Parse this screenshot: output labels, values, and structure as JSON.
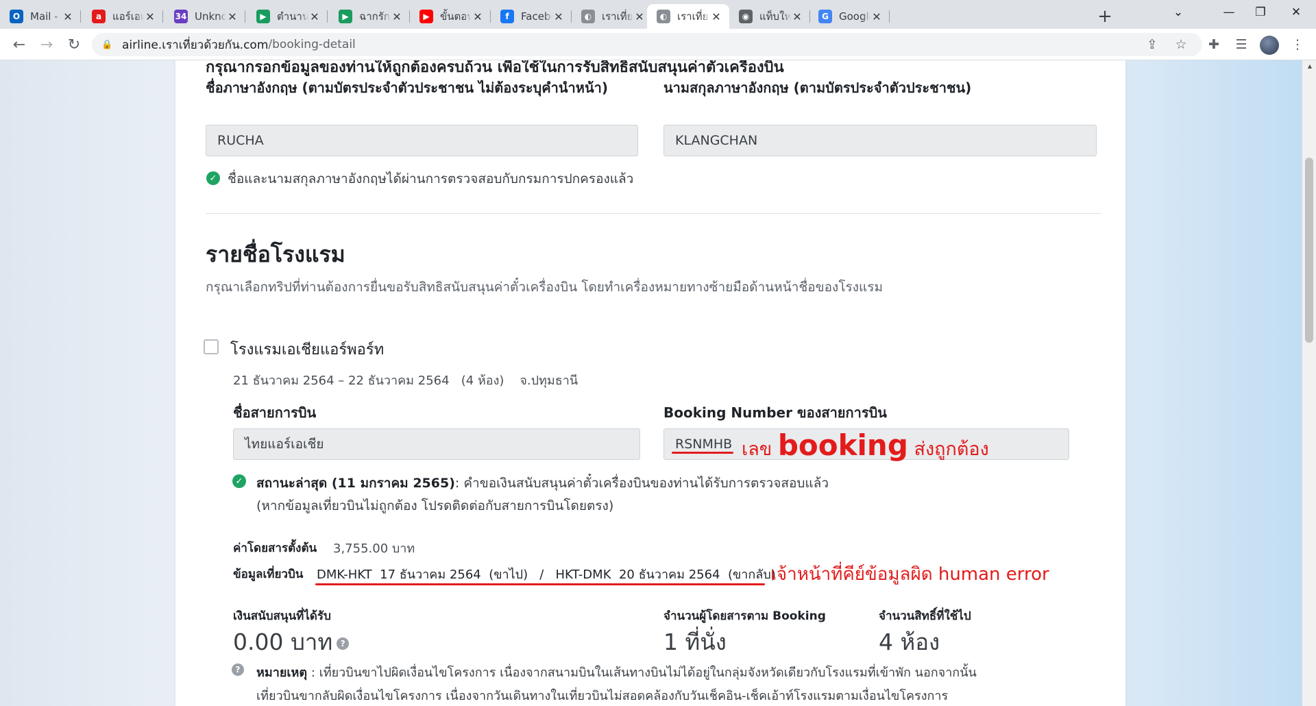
{
  "browser": {
    "tabs": [
      {
        "title": "Mail - หลา",
        "icon": "outlook-icon",
        "color": "#0a64c2",
        "glyph": "O"
      },
      {
        "title": "แอร์เอเชีย |",
        "icon": "airasia-icon",
        "color": "#e31b1b",
        "glyph": "a"
      },
      {
        "title": "Unknown",
        "icon": "channel-34-icon",
        "color": "#6a3dc2",
        "glyph": "34"
      },
      {
        "title": "ตำนานจอมย",
        "icon": "play-icon",
        "color": "#1a9c5f",
        "glyph": "▶"
      },
      {
        "title": "ฉากรักวัยฝั",
        "icon": "play-icon",
        "color": "#1a9c5f",
        "glyph": "▶"
      },
      {
        "title": "ขั้นตอนการ",
        "icon": "youtube-icon",
        "color": "#ff0000",
        "glyph": "▶"
      },
      {
        "title": "Facebook",
        "icon": "facebook-icon",
        "color": "#1877f2",
        "glyph": "f"
      },
      {
        "title": "เราเที่ยวด้วย",
        "icon": "site-icon",
        "color": "#8a8f96",
        "glyph": "◐"
      },
      {
        "title": "เราเที่ยวด้ว",
        "icon": "site-icon",
        "color": "#8a8f96",
        "glyph": "◐"
      },
      {
        "title": "แท็บใหม่",
        "icon": "chrome-icon",
        "color": "#5f6368",
        "glyph": "◉"
      },
      {
        "title": "Google แ",
        "icon": "google-translate-icon",
        "color": "#4285f4",
        "glyph": "G"
      }
    ],
    "url_host": "airline.เราเที่ยวด้วยกัน.com",
    "url_path": "/booking-detail"
  },
  "form": {
    "intro": "กรุณากรอกข้อมูลของท่านให้ถูกต้องครบถ้วน เพื่อใช้ในการรับสิทธิสนับสนุนค่าตั๋วเครื่องบิน",
    "first_name_label": "ชื่อภาษาอังกฤษ (ตามบัตรประจำตัวประชาชน ไม่ต้องระบุคำนำหน้า)",
    "first_name_value": "RUCHA",
    "last_name_label": "นามสกุลภาษาอังกฤษ (ตามบัตรประจำตัวประชาชน)",
    "last_name_value": "KLANGCHAN",
    "verified_text": "ชื่อและนามสกุลภาษาอังกฤษได้ผ่านการตรวจสอบกับกรมการปกครองแล้ว"
  },
  "hotels": {
    "title": "รายชื่อโรงแรม",
    "description": "กรุณาเลือกทริปที่ท่านต้องการยื่นขอรับสิทธิสนับสนุนค่าตั๋วเครื่องบิน โดยทำเครื่องหมายทางซ้ายมือด้านหน้าชื่อของโรงแรม",
    "hotel_name": "โรงแรมเอเชียแอร์พอร์ท",
    "stay": "21 ธันวาคม 2564 – 22 ธันวาคม 2564   (4 ห้อง)    จ.ปทุมธานี",
    "airline_label": "ชื่อสายการบิน",
    "airline_value": "ไทยแอร์เอเชีย",
    "booking_label": "Booking Number ของสายการบิน",
    "booking_value": "RSNMHB",
    "status_label": "สถานะล่าสุด (11 มกราคม 2565)",
    "status_text": ": คำขอเงินสนับสนุนค่าตั๋วเครื่องบินของท่านได้รับการตรวจสอบแล้ว",
    "status_note": "(หากข้อมูลเที่ยวบินไม่ถูกต้อง โปรดติดต่อกับสายการบินโดยตรง)",
    "fare_label": "ค่าโดยสารตั้งต้น",
    "fare_value": "3,755.00 บาท",
    "flight_label": "ข้อมูลเที่ยวบิน",
    "flight_value": "DMK-HKT  17 ธันวาคม 2564  (ขาไป)   /   HKT-DMK  20 ธันวาคม 2564  (ขากลับ)",
    "subsidy_label": "เงินสนับสนุนที่ได้รับ",
    "subsidy_value": "0.00 บาท",
    "passengers_label": "จำนวนผู้โดยสารตาม Booking",
    "passengers_value": "1 ที่นั่ง",
    "rights_label": "จำนวนสิทธิ์ที่ใช้ไป",
    "rights_value": "4 ห้อง",
    "remark_label": "หมายเหตุ",
    "remark_line1": " : เที่ยวบินขาไปผิดเงื่อนไขโครงการ เนื่องจากสนามบินในเส้นทางบินไม่ได้อยู่ในกลุ่มจังหวัดเดียวกับโรงแรมที่เข้าพัก นอกจากนั้น",
    "remark_line2": "เที่ยวบินขากลับผิดเงื่อนไขโครงการ เนื่องจากวันเดินทางในเที่ยวบินไม่สอดคล้องกับวันเช็คอิน-เช็คเอ้าท์โรงแรมตามเงื่อนไขโครงการ"
  },
  "annotations": {
    "booking_prefix": "เลข ",
    "booking_word": "booking",
    "booking_suffix": " ส่งถูกต้อง",
    "flight_note": "เจ้าหน้าที่คีย์ข้อมูลผิด human error",
    "color": "#e31b1b"
  }
}
